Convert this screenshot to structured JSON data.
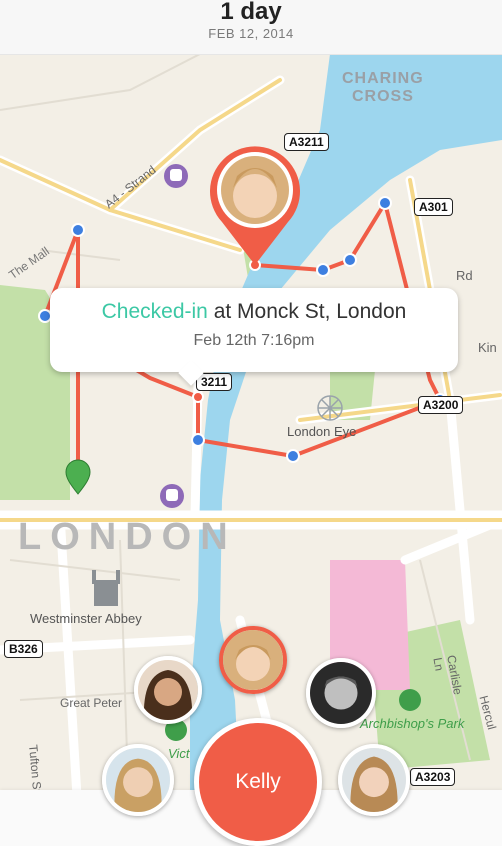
{
  "header": {
    "title": "1 day",
    "date": "FEB 12, 2014"
  },
  "map": {
    "city_label": "LONDON",
    "places": {
      "charing_cross_1": "CHARING",
      "charing_cross_2": "CROSS",
      "london_eye": "London Eye",
      "westminster_abbey": "Westminster Abbey",
      "archbishops_park": "Archbishop's Park",
      "great_peter": "Great Peter",
      "tufton": "Tufton St",
      "victoria": "Vict",
      "the_mall": "The Mall",
      "strand": "A4 - Strand",
      "carlisle": "Carlisle Ln",
      "hercules": "Hercul",
      "kin": "Kin",
      "rd": "Rd"
    },
    "road_labels": {
      "a3211_top": "A3211",
      "a301": "A301",
      "a3211_mid": "3211",
      "a3200": "A3200",
      "b326": "B326",
      "a3203": "A3203"
    }
  },
  "callout": {
    "checked_in": "Checked-in",
    "location": " at Monck St, London",
    "time": "Feb 12th 7:16pm"
  },
  "people": {
    "selected_name": "Kelly"
  },
  "colors": {
    "accent": "#f05d47",
    "checkin": "#3cc8a5",
    "water": "#9dd6ee",
    "park": "#c3e0a8",
    "path_point": "#3d7fe0"
  }
}
